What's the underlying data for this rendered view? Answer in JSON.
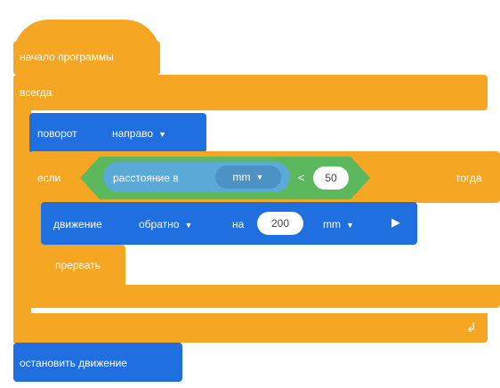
{
  "program": {
    "hat_label": "начало программы",
    "forever_label": "всегда",
    "turn": {
      "label": "поворот",
      "direction": "направо"
    },
    "if_block": {
      "if_label": "если",
      "then_label": "тогда",
      "sensor_label": "расстояние в",
      "sensor_unit": "mm",
      "operator": "<",
      "value": "50"
    },
    "move": {
      "label": "движение",
      "direction": "обратно",
      "on_label": "на",
      "amount": "200",
      "unit": "mm"
    },
    "break_label": "прервать",
    "stop_label": "остановить движение"
  },
  "colors": {
    "control": "#f5a623",
    "motion": "#1f6fe0",
    "sensor": "#5aa9d6",
    "operator": "#5cb85c"
  }
}
